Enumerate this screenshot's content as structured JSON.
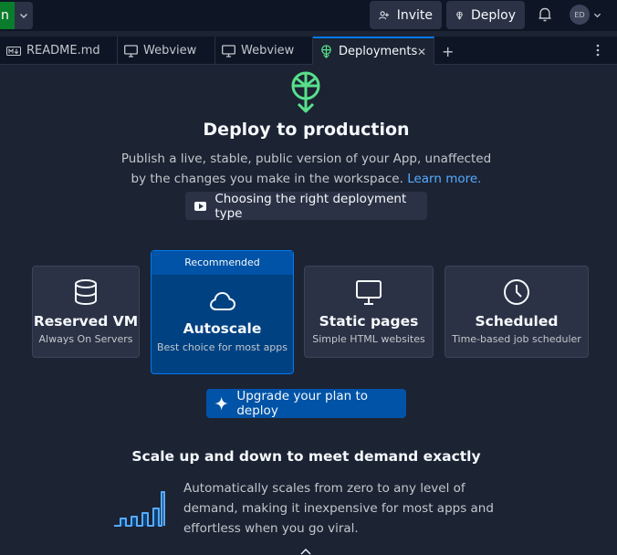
{
  "topbar": {
    "run_label": "n",
    "invite_label": "Invite",
    "deploy_label": "Deploy",
    "avatar_initials": "ED"
  },
  "tabs": [
    {
      "label": "README.md",
      "icon": "markdown-icon"
    },
    {
      "label": "Webview",
      "icon": "monitor-icon"
    },
    {
      "label": "Webview",
      "icon": "monitor-icon"
    },
    {
      "label": "Deployments",
      "icon": "deploy-icon",
      "active": true
    }
  ],
  "main": {
    "title": "Deploy to production",
    "subtitle": "Publish a live, stable, public version of your App, unaffected by the changes you make in the workspace.",
    "learn_more": "Learn more.",
    "video_button": "Choosing the right deployment type"
  },
  "deployment_types": [
    {
      "name": "Reserved VM",
      "desc": "Always On Servers",
      "icon": "database-icon"
    },
    {
      "name": "Autoscale",
      "desc": "Best choice for most apps",
      "icon": "cloud-icon",
      "badge": "Recommended",
      "selected": true
    },
    {
      "name": "Static pages",
      "desc": "Simple HTML websites",
      "icon": "monitor-icon"
    },
    {
      "name": "Scheduled",
      "desc": "Time-based job scheduler",
      "icon": "clock-icon"
    }
  ],
  "upgrade_button": "Upgrade your plan to deploy",
  "section": {
    "title": "Scale up and down to meet demand exactly",
    "body": "Automatically scales from zero to any level of demand, making it inexpensive for most apps and effortless when you go viral."
  },
  "colors": {
    "background": "#1c2333",
    "surface": "#2b3245",
    "accent": "#0079f2",
    "accent_dark": "#0053a6",
    "link": "#57abff",
    "hero_icon": "#58e08a"
  }
}
